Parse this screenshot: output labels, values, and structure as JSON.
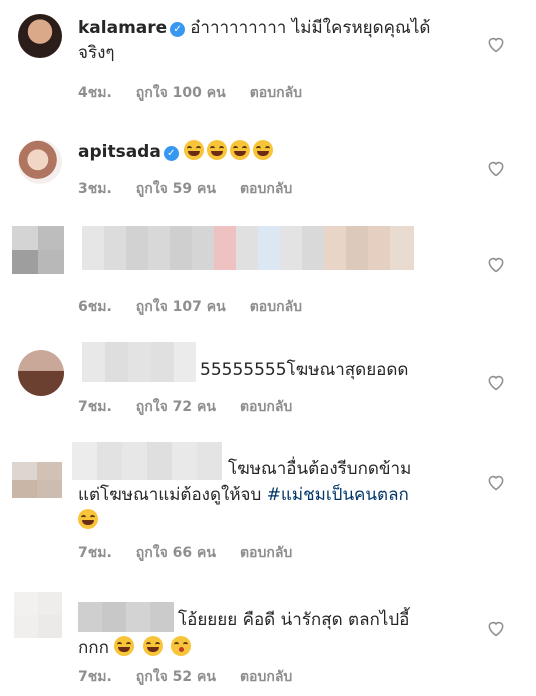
{
  "comments": [
    {
      "username": "kalamare",
      "verified": true,
      "text_line1": "อ๋าาาาาาาาา ไม่มีใครหยุดคุณได้",
      "text_line2": "จริงๆ",
      "time": "4ชม.",
      "likes": "ถูกใจ 100 คน",
      "reply": "ตอบกลับ"
    },
    {
      "username": "apitsada",
      "verified": true,
      "emojis": [
        "face-with-tears-of-joy",
        "face-with-tears-of-joy",
        "face-with-tears-of-joy",
        "face-with-tears-of-joy"
      ],
      "time": "3ชม.",
      "likes": "ถูกใจ 59 คน",
      "reply": "ตอบกลับ"
    },
    {
      "username_blurred": true,
      "time": "6ชม.",
      "likes": "ถูกใจ 107 คน",
      "reply": "ตอบกลับ"
    },
    {
      "username_blurred": true,
      "text": "55555555โฆษณาสุดยอดด",
      "time": "7ชม.",
      "likes": "ถูกใจ 72 คน",
      "reply": "ตอบกลับ"
    },
    {
      "username_blurred": true,
      "text_line1": "โฆษณาอื่นต้องรีบกดข้าม",
      "text_line2": "แต่โฆษณาแม่ต้องดูให้จบ",
      "hashtag": "#แม่ชมเป็นคนตลก",
      "emojis": [
        "face-with-tears-of-joy"
      ],
      "time": "7ชม.",
      "likes": "ถูกใจ 66 คน",
      "reply": "ตอบกลับ"
    },
    {
      "username_blurred": true,
      "text_line1": "โอ้ยยยย คือดี น่ารักสุด ตลกไปอี้",
      "text_line2": "กกก",
      "emojis": [
        "grinning-face",
        "grinning-face",
        "face-blowing-kiss"
      ],
      "time": "7ชม.",
      "likes": "ถูกใจ 52 คน",
      "reply": "ตอบกลับ"
    }
  ],
  "icons": {
    "like": "heart-outline-icon",
    "verified": "verified-badge-icon"
  },
  "colors": {
    "text": "#262626",
    "meta": "#8e8e8e",
    "verified": "#3897f0",
    "hashtag": "#003569"
  }
}
